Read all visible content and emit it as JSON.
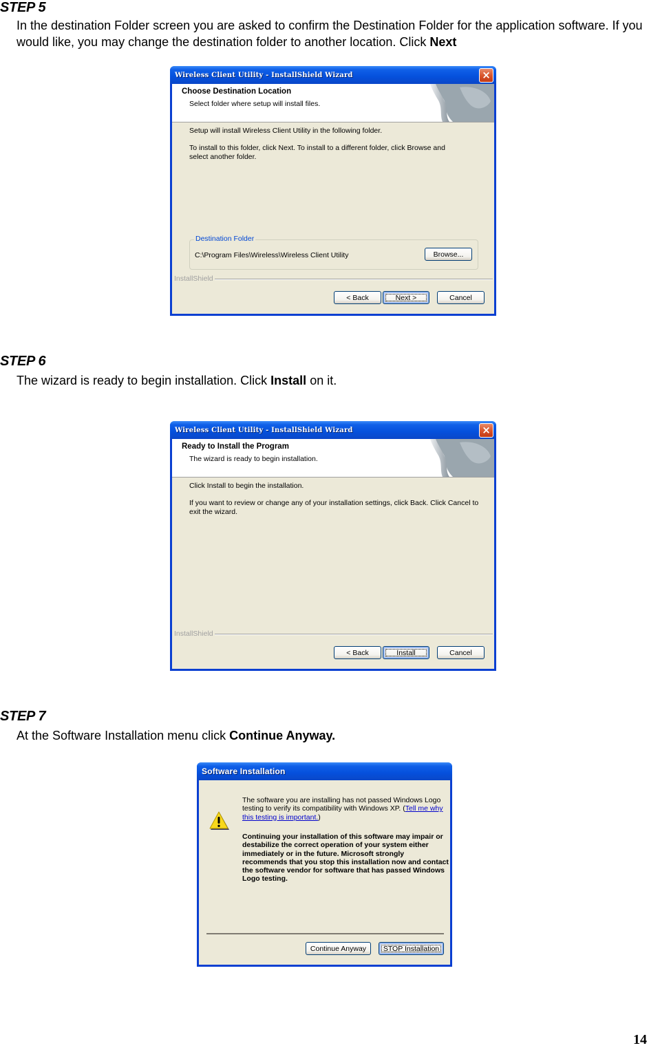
{
  "steps": [
    {
      "title": "STEP 5",
      "text_before": "In the destination Folder screen you are asked to confirm the Destination Folder for the application software. If you would like, you may change the destination folder to another location. Click ",
      "text_bold": "Next",
      "text_after": "",
      "dialog": {
        "window_title": "Wireless Client Utility - InstallShield Wizard",
        "header_title": "Choose Destination Location",
        "header_subtitle": "Select folder where setup will install files.",
        "line1": "Setup will install Wireless Client Utility in the following folder.",
        "line2": "To install to this folder, click Next. To install to a different folder, click Browse and select another folder.",
        "group_label": "Destination Folder",
        "destination_path": "C:\\Program Files\\Wireless\\Wireless Client Utility",
        "browse_label": "Browse...",
        "brand_label": "InstallShield",
        "back_label": "< Back",
        "next_label": "Next >",
        "cancel_label": "Cancel"
      }
    },
    {
      "title": "STEP 6",
      "text_before": "The wizard is ready to begin installation. Click ",
      "text_bold": "Install",
      "text_after": " on it.",
      "dialog": {
        "window_title": "Wireless Client Utility - InstallShield Wizard",
        "header_title": "Ready to Install the Program",
        "header_subtitle": "The wizard is ready to begin installation.",
        "line1": "Click Install to begin the installation.",
        "line2": "If you want to review or change any of your installation settings, click Back. Click Cancel to exit the wizard.",
        "brand_label": "InstallShield",
        "back_label": "< Back",
        "install_label": "Install",
        "cancel_label": "Cancel"
      }
    },
    {
      "title": "STEP 7",
      "text_before": "At the Software Installation menu click ",
      "text_bold": "Continue Anyway.",
      "text_after": "",
      "dialog": {
        "window_title": "Software Installation",
        "warning_text": "The software you are installing has not passed Windows Logo testing to verify its compatibility with Windows XP. (",
        "warning_link": "Tell me why this testing is important.",
        "warning_text_end": ")",
        "warning_bold": "Continuing your installation of this software may impair or destabilize the correct operation of your system either immediately or in the future. Microsoft strongly recommends that you stop this installation now and contact the software vendor for software that has passed Windows Logo testing.",
        "continue_label": "Continue Anyway",
        "stop_label": "STOP Installation"
      }
    }
  ],
  "icons": {
    "close": "×",
    "warning": "!"
  },
  "page_number": "14"
}
